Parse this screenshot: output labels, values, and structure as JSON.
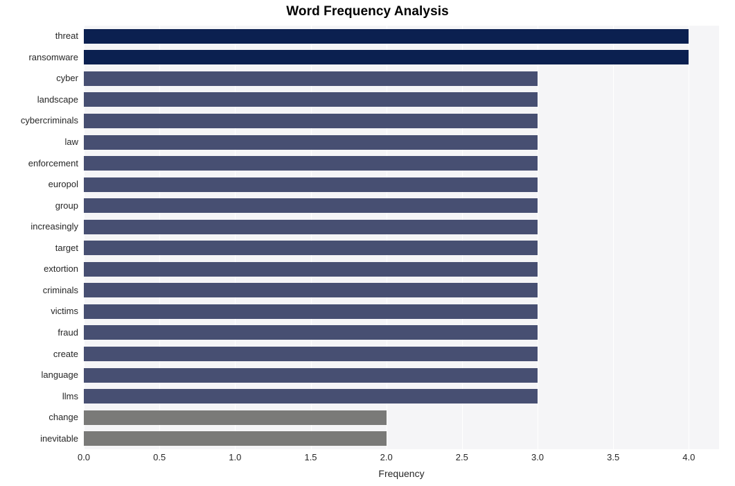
{
  "chart_data": {
    "type": "bar",
    "orientation": "horizontal",
    "title": "Word Frequency Analysis",
    "xlabel": "Frequency",
    "ylabel": "",
    "xlim": [
      0.0,
      4.2
    ],
    "xticks": [
      "0.0",
      "0.5",
      "1.0",
      "1.5",
      "2.0",
      "2.5",
      "3.0",
      "3.5",
      "4.0"
    ],
    "xtick_values": [
      0.0,
      0.5,
      1.0,
      1.5,
      2.0,
      2.5,
      3.0,
      3.5,
      4.0
    ],
    "grid": true,
    "grid_axis": "x",
    "grid_color": "#ffffff",
    "plot_background": "#f5f5f7",
    "figure_background": "#ffffff",
    "legend": null,
    "categories": [
      "threat",
      "ransomware",
      "cyber",
      "landscape",
      "cybercriminals",
      "law",
      "enforcement",
      "europol",
      "group",
      "increasingly",
      "target",
      "extortion",
      "criminals",
      "victims",
      "fraud",
      "create",
      "language",
      "llms",
      "change",
      "inevitable"
    ],
    "values": [
      4,
      4,
      3,
      3,
      3,
      3,
      3,
      3,
      3,
      3,
      3,
      3,
      3,
      3,
      3,
      3,
      3,
      3,
      2,
      2
    ],
    "bar_colors": [
      "#0b2050",
      "#0b2050",
      "#474f72",
      "#474f72",
      "#474f72",
      "#474f72",
      "#474f72",
      "#474f72",
      "#474f72",
      "#474f72",
      "#474f72",
      "#474f72",
      "#474f72",
      "#474f72",
      "#474f72",
      "#474f72",
      "#474f72",
      "#474f72",
      "#7a7a78",
      "#7a7a78"
    ],
    "color_key": {
      "frequency_4": "#0b2050",
      "frequency_3": "#474f72",
      "frequency_2": "#7a7a78"
    }
  }
}
